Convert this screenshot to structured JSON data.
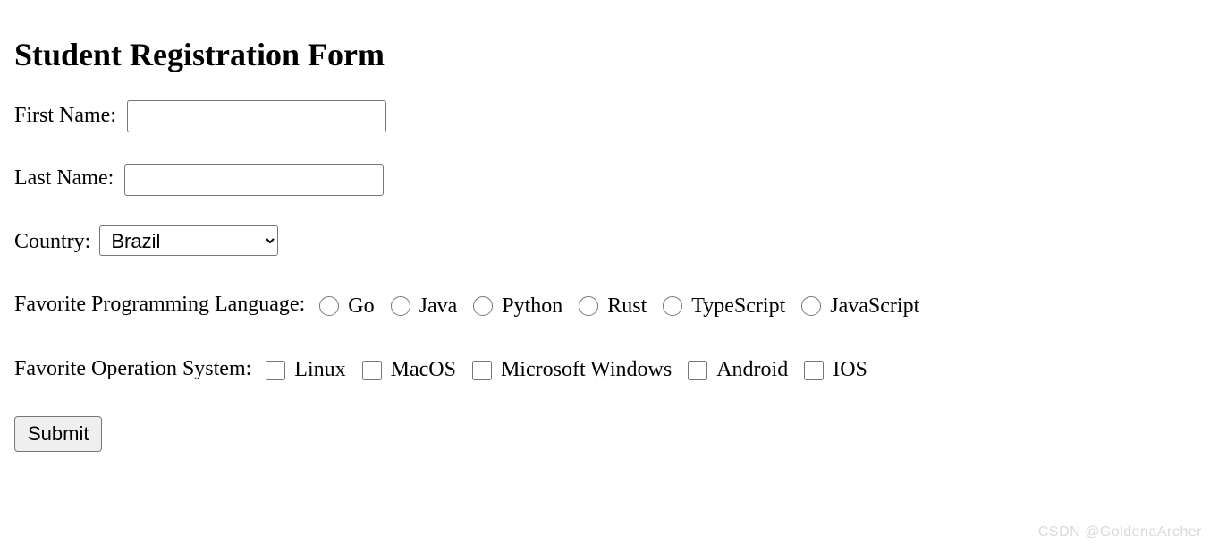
{
  "form": {
    "title": "Student Registration Form",
    "first_name_label": "First Name:",
    "first_name_value": "",
    "last_name_label": "Last Name:",
    "last_name_value": "",
    "country_label": "Country:",
    "country_selected": "Brazil",
    "lang_label": "Favorite Programming Language:",
    "langs": {
      "0": "Go",
      "1": "Java",
      "2": "Python",
      "3": "Rust",
      "4": "TypeScript",
      "5": "JavaScript"
    },
    "os_label": "Favorite Operation System:",
    "oses": {
      "0": "Linux",
      "1": "MacOS",
      "2": "Microsoft Windows",
      "3": "Android",
      "4": "IOS"
    },
    "submit_label": "Submit"
  },
  "watermark": "CSDN @GoldenaArcher"
}
